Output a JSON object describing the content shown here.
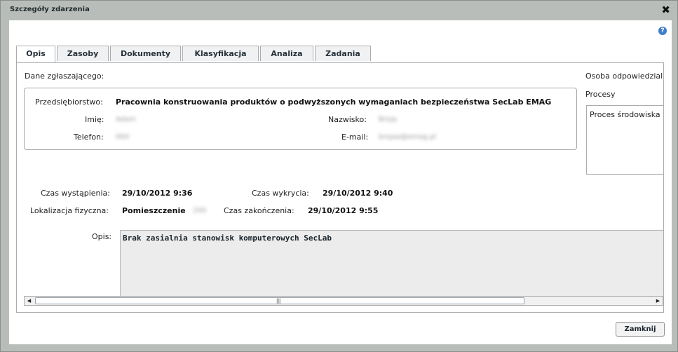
{
  "dialog": {
    "title": "Szczegóły zdarzenia",
    "close_icon": "✖",
    "help_icon": "?"
  },
  "tabs": [
    {
      "label": "Opis",
      "active": true
    },
    {
      "label": "Zasoby"
    },
    {
      "label": "Dokumenty"
    },
    {
      "label": "Klasyfikacja"
    },
    {
      "label": "Analiza"
    },
    {
      "label": "Zadania"
    }
  ],
  "reporter": {
    "section_label": "Dane zgłaszającego:",
    "company_label": "Przedsiębiorstwo:",
    "company_value": "Pracownia konstruowania produktów o podwyższonych wymaganiach bezpieczeństwa SecLab EMAG",
    "first_name_label": "Imię:",
    "first_name_value": "Adam",
    "last_name_label": "Nazwisko:",
    "last_name_value": "Broja",
    "phone_label": "Telefon:",
    "phone_value": "000",
    "email_label": "E-mail:",
    "email_value": "brojaa@emag.pl"
  },
  "side": {
    "responsible_label": "Osoba odpowiedzial",
    "processes_label": "Procesy",
    "process_item": "Proces środowiska"
  },
  "times": {
    "occurred_label": "Czas wystąpienia:",
    "occurred_value": "29/10/2012 9:36",
    "detected_label": "Czas wykrycia:",
    "detected_value": "29/10/2012 9:40",
    "location_label": "Lokalizacja fizyczna:",
    "location_value": "Pomieszczenie",
    "location_blur": "200",
    "ended_label": "Czas zakończenia:",
    "ended_value": "29/10/2012 9:55"
  },
  "description": {
    "label": "Opis:",
    "value": "Brak zasialnia stanowisk komputerowych SecLab"
  },
  "scrollbar": {
    "left_arrow": "◀",
    "right_arrow": "▶",
    "grip": "||||"
  },
  "footer": {
    "close_label": "Zamknij"
  }
}
